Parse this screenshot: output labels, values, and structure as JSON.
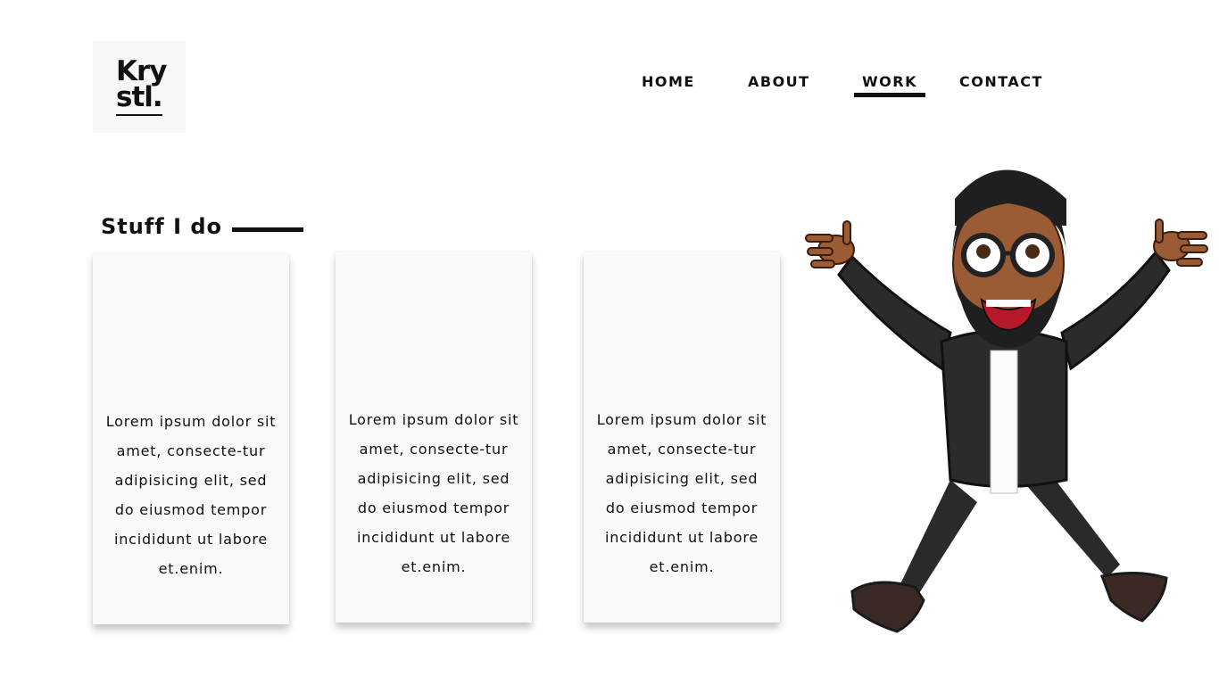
{
  "logo": {
    "line1": "Kry",
    "line2": "stl."
  },
  "nav": {
    "items": [
      {
        "label": "HOME"
      },
      {
        "label": "ABOUT"
      },
      {
        "label": "WORK",
        "active": true
      },
      {
        "label": "CONTACT"
      }
    ]
  },
  "section": {
    "title": "Stuff I do"
  },
  "cards": [
    {
      "text": "Lorem ipsum dolor sit amet, consecte-tur adipisicing elit, sed do eiusmod tempor incididunt ut labore et.enim."
    },
    {
      "text": "Lorem ipsum dolor sit amet, consecte-tur adipisicing elit, sed do eiusmod tempor incididunt ut labore et.enim."
    },
    {
      "text": "Lorem ipsum dolor sit amet, consecte-tur adipisicing elit, sed do eiusmod tempor incididunt ut labore et.enim."
    }
  ],
  "colors": {
    "accent": "#111111",
    "card_bg": "#f9f9f9",
    "logo_bg": "#f7f7f7"
  },
  "icons": {
    "avatar": "cartoon-avatar-jumping"
  }
}
